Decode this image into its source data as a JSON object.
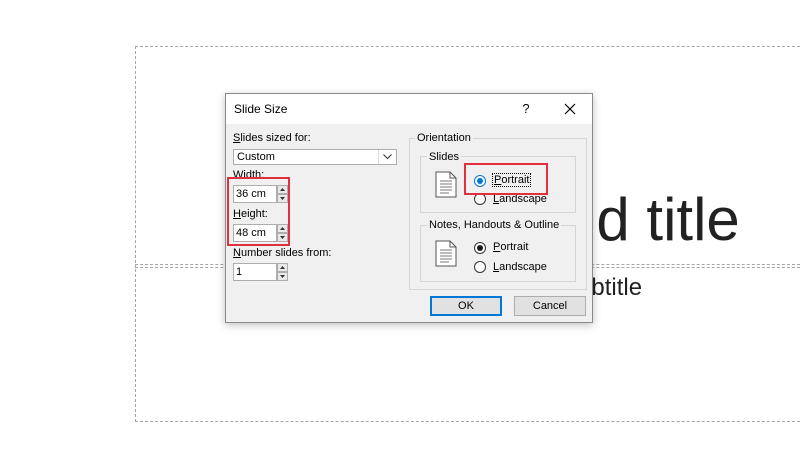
{
  "slide": {
    "title_placeholder": "Click to add title",
    "title_visible": "dd title",
    "subtitle_visible": "ubtitle"
  },
  "dialog": {
    "title": "Slide Size",
    "help_label": "?",
    "slides_sized_for": {
      "label_u": "S",
      "label_rest": "lides sized for:",
      "value": "Custom"
    },
    "width": {
      "label": "Width:",
      "value": "36 cm"
    },
    "height": {
      "label_u": "H",
      "label_rest": "eight:",
      "value": "48 cm"
    },
    "number_from": {
      "label_u": "N",
      "label_rest": "umber slides from:",
      "value": "1"
    },
    "orientation": {
      "label": "Orientation",
      "slides": {
        "label": "Slides",
        "portrait_u": "P",
        "portrait_rest": "ortrait",
        "landscape_u": "L",
        "landscape_rest": "andscape",
        "selected": "portrait"
      },
      "notes": {
        "label": "Notes, Handouts & Outline",
        "portrait_u": "P",
        "portrait_rest": "ortrait",
        "landscape_u": "L",
        "landscape_rest": "andscape",
        "selected": "portrait"
      }
    },
    "ok_label": "OK",
    "cancel_label": "Cancel"
  },
  "colors": {
    "highlight": "#e02f3f",
    "accent": "#0078d7",
    "dialog_bg": "#f0f0f0"
  }
}
